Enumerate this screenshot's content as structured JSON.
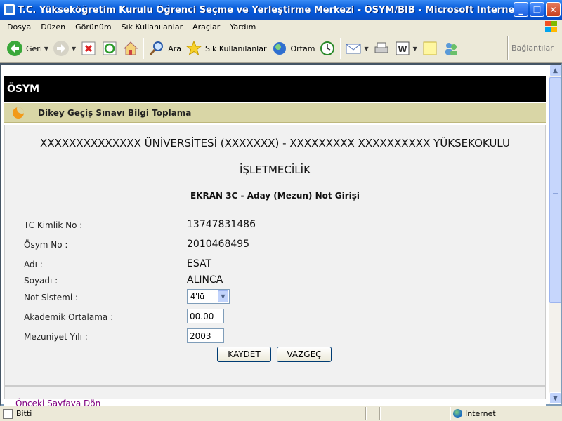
{
  "window": {
    "title": "T.C. Yükseköğretim Kurulu Öğrenci Seçme ve Yerleştirme Merkezi - ÖSYM/BİB - Microsoft Internet Explorer pro...",
    "minimize": "_",
    "maximize": "❐",
    "close": "✕"
  },
  "menu": {
    "items": [
      {
        "label": "Dosya"
      },
      {
        "label": "Düzen"
      },
      {
        "label": "Görünüm"
      },
      {
        "label": "Sık Kullanılanlar"
      },
      {
        "label": "Araçlar"
      },
      {
        "label": "Yardım"
      }
    ]
  },
  "toolbar": {
    "back": "Geri",
    "search": "Ara",
    "favorites": "Sık Kullanılanlar",
    "media": "Ortam",
    "links": "Bağlantılar"
  },
  "page": {
    "header": "ÖSYM",
    "band_title": "Dikey Geçiş Sınavı Bilgi Toplama",
    "university": "XXXXXXXXXXXXXX ÜNİVERSİTESİ (XXXXXXX) - XXXXXXXXX XXXXXXXXXX YÜKSEKOKULU",
    "program": "İŞLETMECİLİK",
    "screen_title": "EKRAN 3C - Aday (Mezun) Not Girişi",
    "fields": {
      "tc_label": "TC Kimlik No :",
      "tc_value": "13747831486",
      "osym_label": "Ösym No :",
      "osym_value": "2010468495",
      "name_label": "Adı :",
      "name_value": "ESAT",
      "surname_label": "Soyadı :",
      "surname_value": "ALINCA",
      "grade_system_label": "Not Sistemi :",
      "grade_system_value": "4'lü",
      "gpa_label": "Akademik Ortalama :",
      "gpa_value": "00.00",
      "grad_year_label": "Mezuniyet Yılı :",
      "grad_year_value": "2003"
    },
    "save_button": "KAYDET",
    "cancel_button": "VAZGEÇ",
    "prev_link": "Önceki Sayfaya Dön"
  },
  "status": {
    "text": "Bitti",
    "zone": "Internet"
  }
}
